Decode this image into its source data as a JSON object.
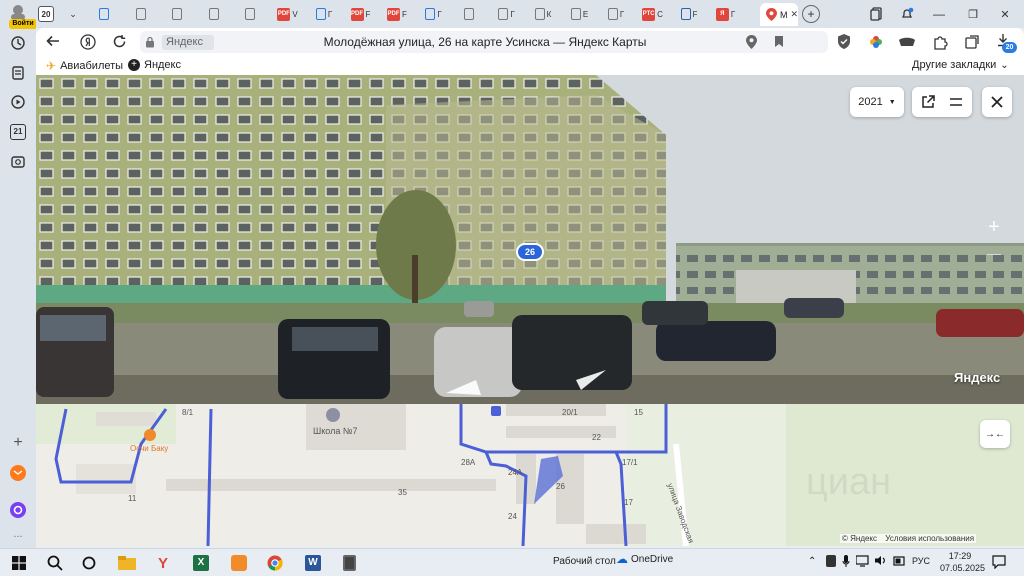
{
  "sidebar": {
    "login_label": "Войти",
    "icons": [
      "history-icon",
      "bookmarks-icon",
      "play-icon",
      "calendar-icon",
      "screenshot-icon"
    ],
    "calendar_label": "21",
    "add_label": "+",
    "more_label": "..."
  },
  "tabs": {
    "counter": "20",
    "items": [
      {
        "label": "",
        "color": "#2b7be4",
        "icon": "cloud-icon"
      },
      {
        "label": "",
        "color": "#777777",
        "icon": "doc-icon"
      },
      {
        "label": "",
        "color": "#777777",
        "icon": "page-icon"
      },
      {
        "label": "",
        "color": "#777777",
        "icon": "page-icon"
      },
      {
        "label": "",
        "color": "#777777",
        "icon": "page-icon"
      },
      {
        "label": "V",
        "color": "#e0463b",
        "icon": "pdf-icon",
        "fav": "PDF"
      },
      {
        "label": "Г",
        "color": "#2b7be4",
        "icon": "mail-icon"
      },
      {
        "label": "F",
        "color": "#e0463b",
        "icon": "pdf-icon",
        "fav": "PDF"
      },
      {
        "label": "F",
        "color": "#e0463b",
        "icon": "pdf-icon",
        "fav": "PDF"
      },
      {
        "label": "Г",
        "color": "#2b7be4",
        "icon": "mail-icon"
      },
      {
        "label": "",
        "color": "#777777",
        "icon": "doc-icon"
      },
      {
        "label": "Г",
        "color": "#777777",
        "icon": "page-icon"
      },
      {
        "label": "К",
        "color": "#777777",
        "icon": "page-icon"
      },
      {
        "label": "Е",
        "color": "#777777",
        "icon": "page-icon"
      },
      {
        "label": "Г",
        "color": "#777777",
        "icon": "page-icon"
      },
      {
        "label": "С",
        "color": "#e0463b",
        "icon": "rts-icon",
        "fav": "РТС"
      },
      {
        "label": "F",
        "color": "#2f5fb0",
        "icon": "eagle-icon"
      },
      {
        "label": "Г",
        "color": "#e0463b",
        "icon": "yandex-icon",
        "fav": "Я"
      }
    ],
    "active_label": "M",
    "new_tab": "+"
  },
  "window_controls": {
    "minimize": "—",
    "maximize": "❐",
    "close": "✕"
  },
  "toolbar": {
    "site_name": "Яндекс",
    "page_title": "Молодёжная улица, 26 на карте Усинска — Яндекс Карты",
    "downloads_badge": "20"
  },
  "bookmarks": {
    "items": [
      {
        "label": "Авиабилеты"
      },
      {
        "label": "Яндекс"
      }
    ],
    "other": "Другие закладки"
  },
  "panorama": {
    "year": "2021",
    "house_marker": "26",
    "watermark": "Яндекс",
    "zoom_in": "+",
    "zoom_out": "—"
  },
  "map": {
    "labels": {
      "school": "Школа №7",
      "cafe": "Осчи Баку",
      "street": "улица Заводская",
      "n8_1": "8/1",
      "n20_1": "20/1",
      "n15": "15",
      "n22": "22",
      "n17_1": "17/1",
      "n28a": "28А",
      "n24a": "24А",
      "n26": "26",
      "n35": "35",
      "n11": "11",
      "n24": "24",
      "n17": "17",
      "n6": "6"
    },
    "copyright": "© Яндекс",
    "terms": "Условия использования",
    "collapse": "→←"
  },
  "taskbar": {
    "desktop_label": "Рабочий стол",
    "onedrive_label": "OneDrive",
    "lang": "РУС",
    "time": "17:29",
    "date": "07.05.2025",
    "apps": [
      "start-icon",
      "search-icon",
      "cortana-icon",
      "explorer-icon",
      "yandex-browser-icon",
      "excel-icon",
      "notes-icon",
      "chrome-icon",
      "word-icon",
      "calculator-icon"
    ]
  }
}
